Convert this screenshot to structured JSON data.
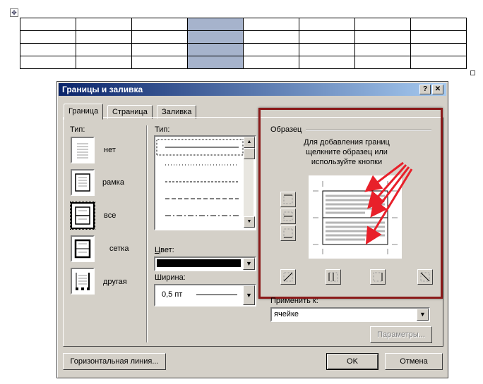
{
  "document": {
    "table_rows": 4,
    "table_cols": 8,
    "selected_column": 4,
    "selection_color": "#a6b3cc"
  },
  "dialog": {
    "title": "Границы и заливка",
    "help_button": "?",
    "close_button": "✕",
    "tabs": [
      {
        "label": "Граница",
        "active": true
      },
      {
        "label": "Страница",
        "active": false
      },
      {
        "label": "Заливка",
        "active": false
      }
    ],
    "type_section": {
      "label": "Тип:",
      "presets": [
        {
          "label": "нет"
        },
        {
          "label": "рамка"
        },
        {
          "label": "все",
          "selected": true
        },
        {
          "label": "сетка"
        },
        {
          "label": "другая"
        }
      ]
    },
    "line_style": {
      "label": "Тип:",
      "styles": [
        "solid",
        "dotted",
        "dashed",
        "long-dash",
        "dash-dot"
      ],
      "selected": "solid"
    },
    "color": {
      "label": "Цвет:",
      "value": "#000000"
    },
    "width": {
      "label": "Ширина:",
      "value": "0,5 пт"
    },
    "preview": {
      "label": "Образец",
      "hint": "Для добавления границ щелкните образец или используйте кнопки",
      "highlight_color": "#8b1a1a",
      "arrow_color": "#e8202a"
    },
    "apply_to": {
      "label": "Применить к:",
      "value": "ячейке"
    },
    "options_button": "Параметры...",
    "horizontal_line_button": "Горизонтальная линия...",
    "ok_button": "OK",
    "cancel_button": "Отмена"
  }
}
